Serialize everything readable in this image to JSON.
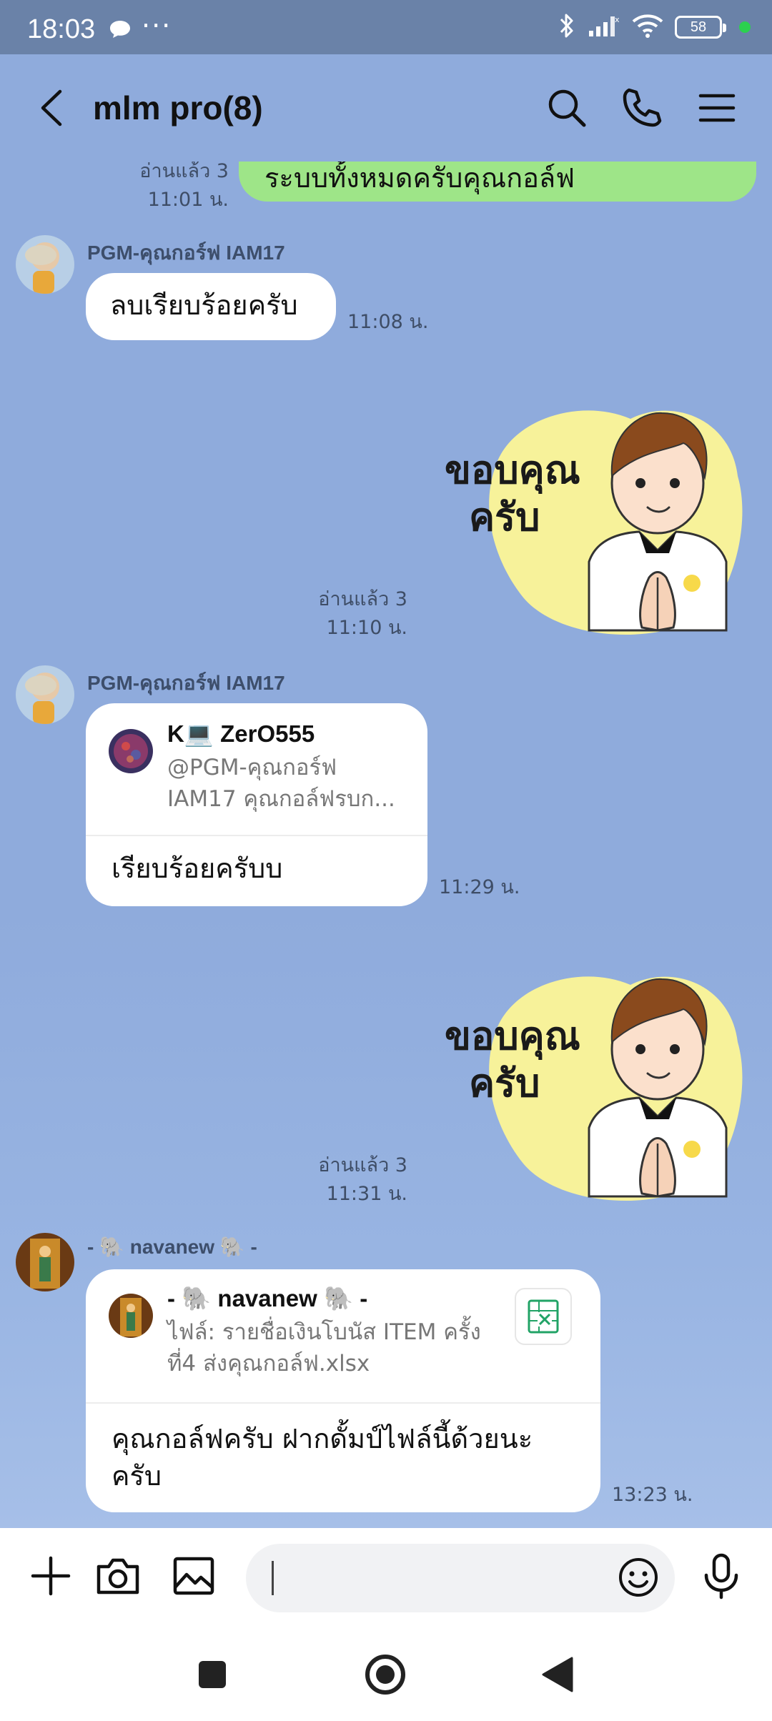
{
  "status_bar": {
    "time": "18:03",
    "more": "···",
    "battery": "58",
    "icons": [
      "chat-notification-icon",
      "bluetooth-icon",
      "signal-icon",
      "wifi-icon",
      "battery-icon"
    ]
  },
  "header": {
    "title": "mlm pro(8)",
    "icons": [
      "back-icon",
      "search-icon",
      "phone-icon",
      "menu-icon"
    ]
  },
  "messages": [
    {
      "type": "text",
      "outgoing": true,
      "text": "ระบบทั้งหมดครับคุณกอล์ฟ",
      "read": "อ่านแล้ว 3",
      "time": "11:01 น."
    },
    {
      "type": "text",
      "outgoing": false,
      "sender": "PGM-คุณกอร์ฟ IAM17",
      "text": "ลบเรียบร้อยครับ",
      "time": "11:08 น."
    },
    {
      "type": "sticker",
      "outgoing": true,
      "sticker_text": [
        "ขอบคุณ",
        "ครับ"
      ],
      "read": "อ่านแล้ว 3",
      "time": "11:10 น."
    },
    {
      "type": "reply",
      "outgoing": false,
      "sender": "PGM-คุณกอร์ฟ IAM17",
      "quoted_name": "K💻 ZerO555",
      "quoted_text": [
        "@PGM-คุณกอร์ฟ",
        "IAM17 คุณกอล์ฟรบก..."
      ],
      "text": "เรียบร้อยครับบ",
      "time": "11:29 น."
    },
    {
      "type": "sticker",
      "outgoing": true,
      "sticker_text": [
        "ขอบคุณ",
        "ครับ"
      ],
      "read": "อ่านแล้ว 3",
      "time": "11:31 น."
    },
    {
      "type": "reply",
      "outgoing": false,
      "sender": "- 🐘 navanew 🐘 -",
      "quoted_name": "- 🐘 navanew 🐘 -",
      "quoted_text": [
        "ไฟล์: รายชื่อเงินโบนัส ITEM ครั้ง",
        "ที่4 ส่งคุณกอล์ฟ.xlsx"
      ],
      "text": [
        "คุณกอล์ฟครับ ฝากดั้มป์ไฟล์นี้ด้วยนะ",
        "ครับ"
      ],
      "time": "13:23 น."
    }
  ],
  "input_bar": {
    "value": "",
    "placeholder": "",
    "icons": [
      "plus-icon",
      "camera-icon",
      "image-icon",
      "emoji-icon",
      "microphone-icon"
    ]
  },
  "nav_bar": {
    "icons": [
      "recents-icon",
      "home-icon",
      "back-nav-icon"
    ]
  },
  "colors": {
    "chat_background": "#8fabdc",
    "status_bar": "#6a82a8",
    "outgoing_bubble": "#9ee588",
    "incoming_bubble": "#ffffff",
    "sticker_blob": "#f7f29a",
    "excel_green": "#21a366"
  }
}
